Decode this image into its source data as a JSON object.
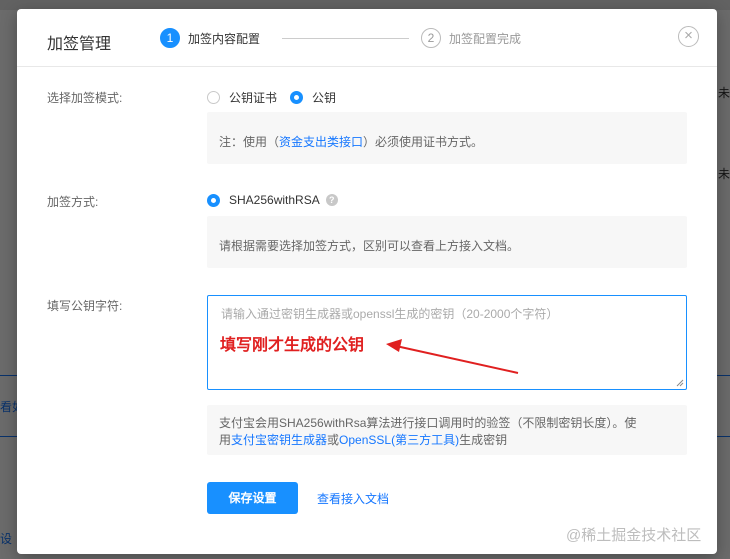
{
  "background": {
    "bar_left_top": "看如",
    "bar_left_bottom": "设",
    "right_1": "未",
    "right_2": "未"
  },
  "modal": {
    "title": "加签管理",
    "steps": [
      {
        "num": "1",
        "label": "加签内容配置",
        "active": true
      },
      {
        "num": "2",
        "label": "加签配置完成",
        "active": false
      }
    ],
    "close_glyph": "×"
  },
  "form": {
    "mode": {
      "label": "选择加签模式:",
      "options": [
        {
          "label": "公钥证书",
          "checked": false
        },
        {
          "label": "公钥",
          "checked": true
        }
      ],
      "note_prefix": "注：使用（",
      "note_link": "资金支出类接口",
      "note_suffix": "）必须使用证书方式。"
    },
    "method": {
      "label": "加签方式:",
      "option": "SHA256withRSA",
      "help_glyph": "?",
      "note": "请根据需要选择加签方式，区别可以查看上方接入文档。"
    },
    "public_key": {
      "label": "填写公钥字符:",
      "placeholder": "请输入通过密钥生成器或openssl生成的密钥（20-2000个字符）",
      "annotation": "填写刚才生成的公钥",
      "note_line1": "支付宝会用SHA256withRsa算法进行接口调用时的验签（不限制密钥长度）。使",
      "note_line2_prefix": "用",
      "note_link1": "支付宝密钥生成器",
      "note_or": "或",
      "note_link2": "OpenSSL(第三方工具)",
      "note_line2_suffix": "生成密钥"
    },
    "save_button": "保存设置",
    "doc_link": "查看接入文档"
  },
  "watermark": "@稀土掘金技术社区",
  "colors": {
    "primary": "#1890ff",
    "annotation_red": "#e02020",
    "link": "#1677ff"
  }
}
